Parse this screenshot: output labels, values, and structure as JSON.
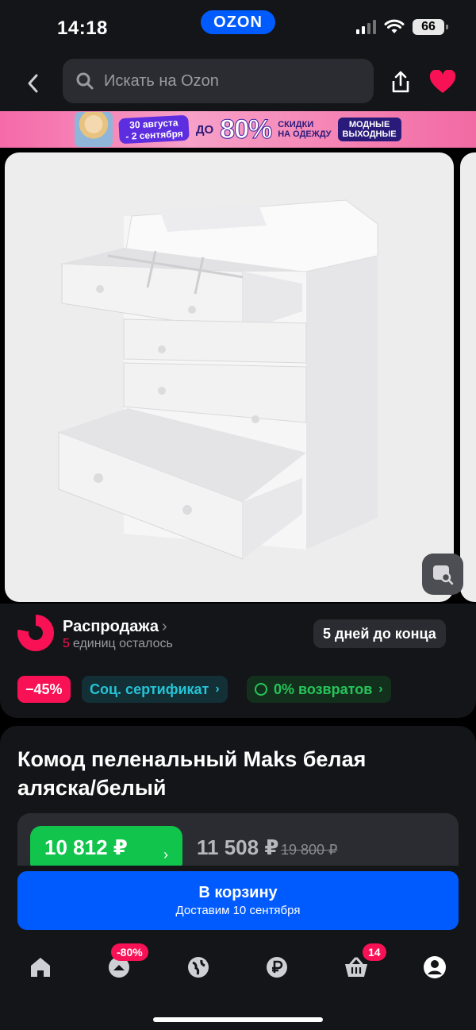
{
  "status_bar": {
    "time": "14:18",
    "battery": "66"
  },
  "brand": {
    "logo_text": "OZON",
    "accent": "#005bff",
    "sale_red": "#f91155",
    "green": "#10c44c"
  },
  "header": {
    "back_icon": "chevron-left-icon",
    "search_placeholder": "Искать на Ozon",
    "share_icon": "share-icon",
    "favorite_icon": "heart-icon"
  },
  "banner": {
    "dates": "30 августа\n- 2 сентября",
    "upto": "ДО",
    "percent": "80%",
    "subtitle": "СКИДКИ\nНА ОДЕЖДУ",
    "tag": "МОДНЫЕ\nВЫХОДНЫЕ"
  },
  "sale": {
    "title": "Распродажа",
    "chevron": "›",
    "units_count": "5",
    "units_text": "единиц осталось",
    "days_left": "5 дней до конца"
  },
  "chips": {
    "discount": "−45%",
    "certificate": "Соц. сертификат",
    "returns": "0% возвратов",
    "arrow": "›"
  },
  "product": {
    "title": "Комод пеленальный Maks белая аляска/белый",
    "price_card": "10 812 ₽",
    "price_regular": "11 508 ₽",
    "price_old": "19 800 ₽"
  },
  "cart_button": {
    "label": "В корзину",
    "delivery": "Доставим 10 сентября"
  },
  "tabbar": {
    "tabs": [
      {
        "name": "home-icon"
      },
      {
        "name": "fashion-icon",
        "badge": "-80%"
      },
      {
        "name": "globe-icon"
      },
      {
        "name": "ruble-icon"
      },
      {
        "name": "cart-icon",
        "badge": "14"
      },
      {
        "name": "profile-icon"
      }
    ]
  }
}
